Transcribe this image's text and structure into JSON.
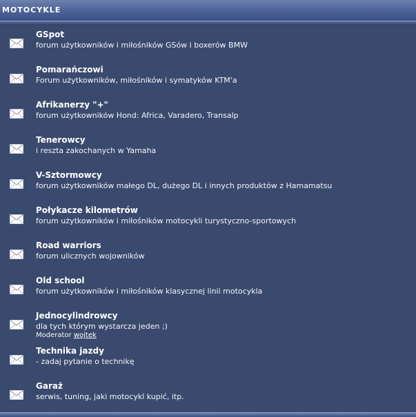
{
  "category": {
    "title": "MOTOCYKLE"
  },
  "forums": [
    {
      "name": "GSpot",
      "description": "forum użytkowników i miłośników GSów i boxerów BMW"
    },
    {
      "name": "Pomarańczowi",
      "description": "Forum użytkowników, miłośników i symatyków KTM'a"
    },
    {
      "name": "Afrikanerzy \"+\"",
      "description": "forum użytkowników Hond: Africa, Varadero, Transalp"
    },
    {
      "name": "Tenerowcy",
      "description": "i reszta zakochanych w Yamaha"
    },
    {
      "name": "V-Sztormowcy",
      "description": "forum użytkowników małego DL, dużego DL i innych produktów z Hamamatsu"
    },
    {
      "name": "Połykacze kilometrów",
      "description": "forum użytkowników i miłośników motocykli turystyczno-sportowych"
    },
    {
      "name": "Road warriors",
      "description": "forum ulicznych wojowników"
    },
    {
      "name": "Old school",
      "description": "forum użytkowników i miłośników klasycznej linii motocykla"
    },
    {
      "name": "Jednocylindrowcy",
      "description": "dla tych którym wystarcza jeden ;)",
      "moderator_label": "Moderator",
      "moderator_name": "wojtek"
    },
    {
      "name": "Technika jazdy",
      "description": "- zadaj pytanie o technikę"
    },
    {
      "name": "Garaż",
      "description": "serwis, tuning, jaki motocykl kupić, itp."
    }
  ],
  "icon": "envelope-icon"
}
